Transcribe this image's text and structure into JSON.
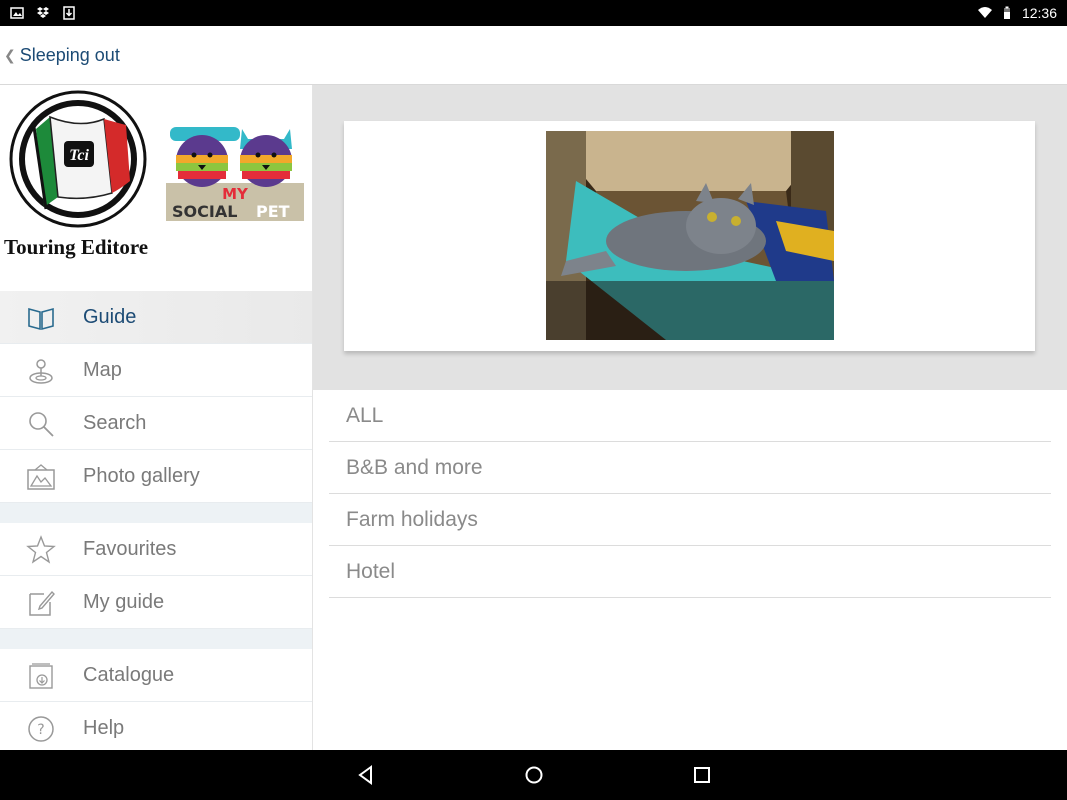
{
  "status_bar": {
    "time": "12:36",
    "left_icons": [
      "image-icon",
      "dropbox-icon",
      "download-icon"
    ],
    "right_icons": [
      "wifi-icon",
      "battery-icon"
    ]
  },
  "action_bar": {
    "back_label": "Sleeping out"
  },
  "sidebar": {
    "publisher_name": "Touring Editore",
    "tci_emblem_text": "Tci",
    "partner_logo_lines": [
      "MY",
      "SOCIAL",
      "PET"
    ],
    "items": [
      {
        "label": "Guide",
        "icon": "book-icon",
        "active": true
      },
      {
        "label": "Map",
        "icon": "map-pin-icon",
        "active": false
      },
      {
        "label": "Search",
        "icon": "search-icon",
        "active": false
      },
      {
        "label": "Photo gallery",
        "icon": "photo-gallery-icon",
        "active": false
      },
      {
        "label": "Favourites",
        "icon": "star-icon",
        "active": false
      },
      {
        "label": "My guide",
        "icon": "edit-icon",
        "active": false
      },
      {
        "label": "Catalogue",
        "icon": "catalogue-download-icon",
        "active": false
      },
      {
        "label": "Help",
        "icon": "help-icon",
        "active": false
      }
    ]
  },
  "main": {
    "categories": [
      "ALL",
      "B&B and more",
      "Farm holidays",
      "Hotel"
    ]
  },
  "colors": {
    "accent": "#1c4b75",
    "menu_text": "#7a7a7a",
    "banner_background": "#e2e2e2",
    "separator": "#edf2f5"
  }
}
